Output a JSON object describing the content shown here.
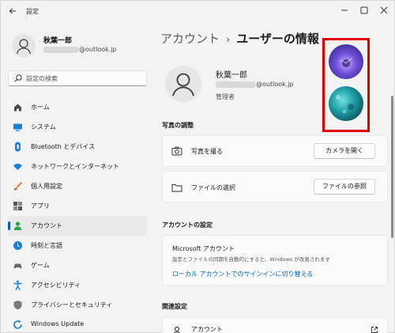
{
  "window": {
    "title": "設定",
    "back_icon": "arrow-left-icon",
    "controls": [
      "minimize-icon",
      "maximize-icon",
      "close-icon"
    ]
  },
  "sidebar": {
    "profile": {
      "name": "秋葉一郎",
      "email_suffix": "@outlook.jp"
    },
    "search": {
      "placeholder": "設定の検索"
    },
    "items": [
      {
        "label": "ホーム",
        "icon": "home-icon",
        "selected": false
      },
      {
        "label": "システム",
        "icon": "system-icon",
        "selected": false
      },
      {
        "label": "Bluetooth とデバイス",
        "icon": "bluetooth-icon",
        "selected": false
      },
      {
        "label": "ネットワークとインターネット",
        "icon": "network-icon",
        "selected": false
      },
      {
        "label": "個人用設定",
        "icon": "brush-icon",
        "selected": false
      },
      {
        "label": "アプリ",
        "icon": "apps-icon",
        "selected": false
      },
      {
        "label": "アカウント",
        "icon": "account-icon",
        "selected": true
      },
      {
        "label": "時刻と言語",
        "icon": "time-language-icon",
        "selected": false
      },
      {
        "label": "ゲーム",
        "icon": "gaming-icon",
        "selected": false
      },
      {
        "label": "アクセシビリティ",
        "icon": "accessibility-icon",
        "selected": false
      },
      {
        "label": "プライバシーとセキュリティ",
        "icon": "shield-icon",
        "selected": false
      },
      {
        "label": "Windows Update",
        "icon": "update-icon",
        "selected": false
      }
    ]
  },
  "main": {
    "breadcrumb": {
      "parent": "アカウント",
      "separator": "›",
      "current": "ユーザーの情報"
    },
    "user": {
      "name": "秋葉一郎",
      "email_suffix": "@outlook.jp",
      "role": "管理者"
    },
    "photo_section": {
      "title": "写真の調整",
      "take_photo_label": "写真を撮る",
      "take_photo_button": "カメラを開く",
      "choose_file_label": "ファイルの選択",
      "choose_file_button": "ファイルの参照"
    },
    "account_settings": {
      "title": "アカウントの設定",
      "ms_account_title": "Microsoft アカウント",
      "ms_account_desc": "設定とファイルの同期を自動的にすると、Windows が改善されます",
      "switch_link": "ローカル アカウントでのサインインに切り替える"
    },
    "related": {
      "title": "関連設定",
      "item_label": "アカウント"
    }
  },
  "colors": {
    "accent": "#005fb8",
    "link": "#0067c0",
    "highlight_frame": "#e00000",
    "background": "#f3f3f3"
  }
}
